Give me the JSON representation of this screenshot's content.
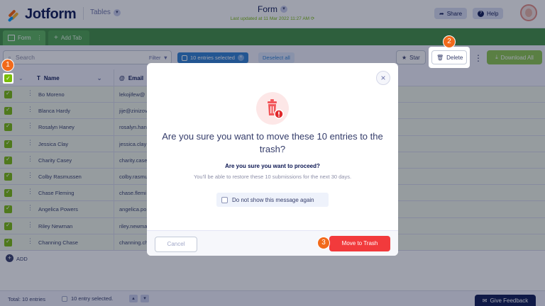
{
  "header": {
    "logo_text": "Jotform",
    "tables_label": "Tables",
    "form_title": "Form",
    "last_updated": "Last updated at 11 Mar 2022 11:27 AM",
    "share_label": "Share",
    "help_label": "Help"
  },
  "tabs": {
    "form_tab_label": "Form",
    "add_tab_label": "Add Tab"
  },
  "toolbar": {
    "search_placeholder": "Search",
    "filter_label": "Filter",
    "selected_label": "10 entries selected",
    "deselect_label": "Deselect all",
    "star_label": "Star",
    "delete_label": "Delete",
    "download_label": "Download All"
  },
  "table": {
    "columns": [
      "Name",
      "Email"
    ],
    "rows": [
      {
        "name": "Bo Moreno",
        "email": "lekojifew@"
      },
      {
        "name": "Blanca Hardy",
        "email": "jije@zinizov"
      },
      {
        "name": "Rosalyn Haney",
        "email": "rosalyn.han"
      },
      {
        "name": "Jessica Clay",
        "email": "jessica.clay"
      },
      {
        "name": "Charity Casey",
        "email": "charity.case"
      },
      {
        "name": "Colby Rasmussen",
        "email": "colby.rasmu"
      },
      {
        "name": "Chase Fleming",
        "email": "chase.flemi"
      },
      {
        "name": "Angelica Powers",
        "email": "angelica.po"
      },
      {
        "name": "Riley Newman",
        "email": "riley.newma"
      },
      {
        "name": "Channing Chase",
        "email": "channing.ch"
      }
    ],
    "add_label": "ADD"
  },
  "footer": {
    "total_label": "Total: 10 entries",
    "selected_label": "10 entry selected.",
    "feedback_label": "Give Feedback"
  },
  "modal": {
    "heading": "Are you sure you want to move these 10 entries to the trash?",
    "question": "Are you sure you want to proceed?",
    "subtext": "You'll be able to restore these 10 submissions for the next 30 days.",
    "dont_show_label": "Do not show this message again",
    "cancel_label": "Cancel",
    "confirm_label": "Move to Trash"
  },
  "steps": {
    "one": "1",
    "two": "2",
    "three": "3"
  },
  "colors": {
    "brand_green": "#78bb07",
    "tabbar_green": "#3e8e40",
    "danger_red": "#f23a3c",
    "step_orange": "#f26a1b",
    "selection_blue": "#2b7ed3"
  }
}
